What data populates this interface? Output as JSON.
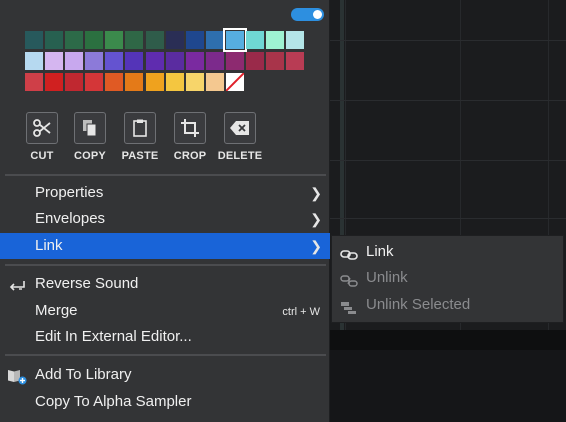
{
  "palette": {
    "rows": [
      [
        "#27595c",
        "#276050",
        "#2c6a48",
        "#2b7040",
        "#3b8a4c",
        "#2f6746",
        "#2f5c4a",
        "#2a2e55",
        "#1f478e",
        "#2e6fae",
        "#56aee0",
        "#6fd8d4",
        "#9ef3d2"
      ],
      [
        "#b4e5e8",
        "#b6d9f0",
        "#d5b6f0",
        "#c8a8ee",
        "#8c7ad9",
        "#6453d0",
        "#5434b8",
        "#5f2caf",
        "#5a2ca0",
        "#7a2aa0",
        "#7c2a8c",
        "#8d2a70",
        "#9a2a4a"
      ],
      [
        "#a8344a",
        "#b83c54",
        "#cf3f48",
        "#d02020",
        "#c02830",
        "#d43638",
        "#e05a24",
        "#e47a18",
        "#efa21e",
        "#f4c640",
        "#f7d56a",
        "#f4c890",
        "none"
      ]
    ],
    "selected": "#56aee0"
  },
  "tools": [
    {
      "label": "CUT",
      "icon": "scissors-icon"
    },
    {
      "label": "COPY",
      "icon": "copy-icon"
    },
    {
      "label": "PASTE",
      "icon": "clipboard-icon"
    },
    {
      "label": "CROP",
      "icon": "crop-icon"
    },
    {
      "label": "DELETE",
      "icon": "backspace-icon"
    }
  ],
  "menu": {
    "properties": "Properties",
    "envelopes": "Envelopes",
    "link": "Link",
    "reverse_sound": "Reverse Sound",
    "merge": "Merge",
    "merge_shortcut": "ctrl + W",
    "edit_external": "Edit In External Editor...",
    "add_to_library": "Add To Library",
    "copy_to_alpha": "Copy To Alpha Sampler"
  },
  "submenu": {
    "link": "Link",
    "unlink": "Unlink",
    "unlink_selected": "Unlink Selected"
  },
  "colors": {
    "accent": "#1964d8",
    "toggle": "#2d8fe0",
    "menu_bg": "#333436"
  }
}
